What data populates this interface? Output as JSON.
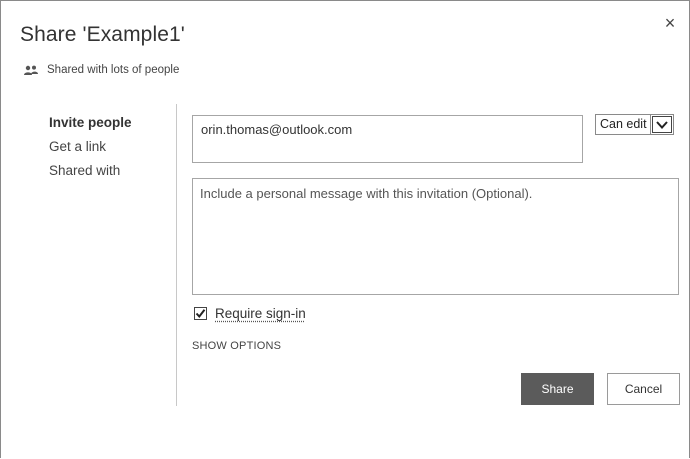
{
  "dialog": {
    "title": "Share 'Example1'",
    "close_glyph": "×",
    "status_icon": "people-icon",
    "status_text": "Shared with lots of people"
  },
  "sidebar": {
    "items": [
      {
        "label": "Invite people",
        "active": true
      },
      {
        "label": "Get a link",
        "active": false
      },
      {
        "label": "Shared with",
        "active": false
      }
    ]
  },
  "invite": {
    "recipient": "orin.thomas@outlook.com",
    "permission": "Can edit",
    "message_placeholder": "Include a personal message with this invitation (Optional).",
    "require_signin_label": "Require sign-in",
    "require_signin_checked": true,
    "show_options_label": "SHOW OPTIONS"
  },
  "buttons": {
    "share_label": "Share",
    "cancel_label": "Cancel"
  },
  "colors": {
    "primary_button": "#5b5b5b",
    "border": "#a6a6a6"
  }
}
